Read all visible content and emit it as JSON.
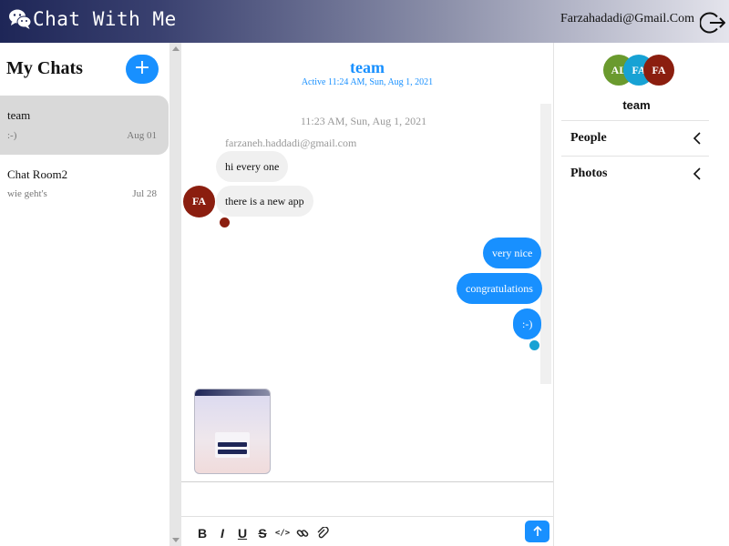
{
  "header": {
    "brand": "Chat With Me",
    "user_email": "Farzahadadi@Gmail.Com",
    "icons": {
      "logo": "wechat-icon",
      "logout": "logout-icon"
    }
  },
  "sidebar": {
    "title": "My Chats",
    "new_chat_label": "+",
    "chats": [
      {
        "name": "team",
        "preview": ":-)",
        "date": "Aug 01",
        "active": true
      },
      {
        "name": "Chat Room2",
        "preview": "wie geht's",
        "date": "Jul 28",
        "active": false
      }
    ]
  },
  "chat": {
    "title": "team",
    "subtitle": "Active 11:24 AM, Sun, Aug 1, 2021",
    "timestamp": "11:23 AM, Sun, Aug 1, 2021",
    "sender": "farzaneh.haddadi@gmail.com",
    "sender_initials": "FA",
    "incoming": [
      "hi every one",
      "there is a new app"
    ],
    "outgoing": [
      "very nice",
      "congratulations",
      ":-)"
    ],
    "attachment_icon": "app-screenshot-thumbnail",
    "composer_placeholder": "",
    "toolbar_icons": [
      "bold-icon",
      "italic-icon",
      "underline-icon",
      "strikethrough-icon",
      "code-icon",
      "link-icon",
      "paperclip-icon"
    ],
    "toolbar_glyphs": {
      "bold": "B",
      "italic": "I",
      "underline": "U",
      "strike": "S",
      "code": "</>"
    },
    "send_icon": "arrow-up-icon"
  },
  "panel": {
    "avatars": [
      {
        "initials": "AL",
        "color": "#6a9a2e"
      },
      {
        "initials": "FA",
        "color": "#17a2d4"
      },
      {
        "initials": "FA",
        "color": "#8b1e0f"
      }
    ],
    "group_name": "team",
    "sections": [
      "People",
      "Photos"
    ]
  },
  "colors": {
    "accent": "#1890ff",
    "header_dark": "#1e2657",
    "active_chat_bg": "#d9d9d9"
  }
}
